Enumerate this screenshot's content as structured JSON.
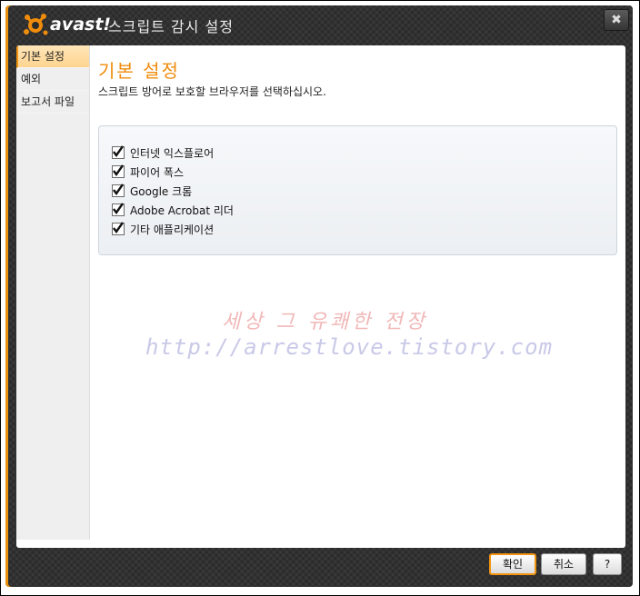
{
  "window": {
    "brand": "avast!",
    "title": "스크립트 감시 설정",
    "close_glyph": "✖"
  },
  "sidebar": {
    "items": [
      {
        "label": "기본 설정",
        "active": true
      },
      {
        "label": "예외",
        "active": false
      },
      {
        "label": "보고서 파일",
        "active": false
      }
    ]
  },
  "main": {
    "heading": "기본 설정",
    "subtitle": "스크립트 방어로 보호할 브라우저를 선택하십시오.",
    "options": [
      {
        "label": "인터넷 익스플로어",
        "checked": true
      },
      {
        "label": "파이어 폭스",
        "checked": true
      },
      {
        "label": "Google 크롬",
        "checked": true
      },
      {
        "label": "Adobe Acrobat 리더",
        "checked": true
      },
      {
        "label": "기타 애플리케이션",
        "checked": true
      }
    ]
  },
  "watermark": {
    "line1": "세상 그 유쾌한 전장",
    "line2": "http://arrestlove.tistory.com"
  },
  "buttons": {
    "ok": "확인",
    "cancel": "취소",
    "help": "?"
  },
  "colors": {
    "accent": "#f08c0b",
    "titlebar": "#2b2b2b"
  }
}
